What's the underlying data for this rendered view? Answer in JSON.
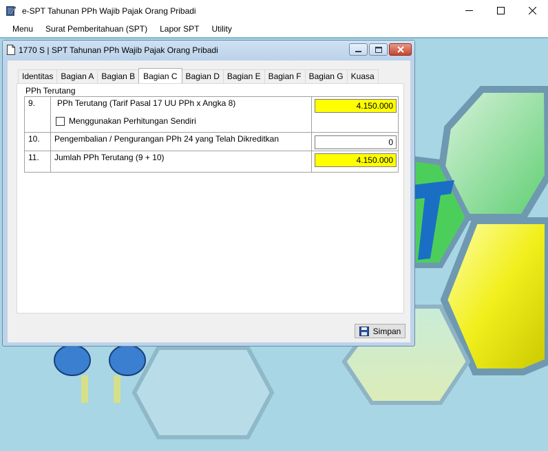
{
  "app": {
    "title": "e-SPT Tahunan PPh Wajib Pajak Orang Pribadi",
    "icon": "notebook-pencil-icon"
  },
  "menu": [
    "Menu",
    "Surat Pemberitahuan (SPT)",
    "Lapor SPT",
    "Utility"
  ],
  "child_window": {
    "title": "1770 S | SPT Tahunan PPh Wajib Pajak Orang Pribadi",
    "icon": "document-icon"
  },
  "tabs": [
    "Identitas",
    "Bagian A",
    "Bagian B",
    "Bagian C",
    "Bagian D",
    "Bagian E",
    "Bagian F",
    "Bagian G",
    "Kuasa"
  ],
  "active_tab": "Bagian C",
  "section": {
    "label": "PPh Terutang",
    "rows": [
      {
        "no": "9.",
        "desc": "PPh Terutang (Tarif Pasal 17 UU PPh x Angka 8)",
        "value": "4.150.000",
        "highlight": true,
        "checkbox_label": "Menggunakan Perhitungan Sendiri",
        "checked": false
      },
      {
        "no": "10.",
        "desc": "Pengembalian / Pengurangan PPh 24 yang Telah Dikreditkan",
        "value": "0",
        "highlight": false
      },
      {
        "no": "11.",
        "desc": "Jumlah PPh Terutang (9 + 10)",
        "value": "4.150.000",
        "highlight": true
      }
    ]
  },
  "buttons": {
    "save": "Simpan"
  },
  "colors": {
    "highlight": "#ffff00",
    "desktop_bg": "#a8d6e4",
    "window_frame": "#bcd3ea"
  }
}
